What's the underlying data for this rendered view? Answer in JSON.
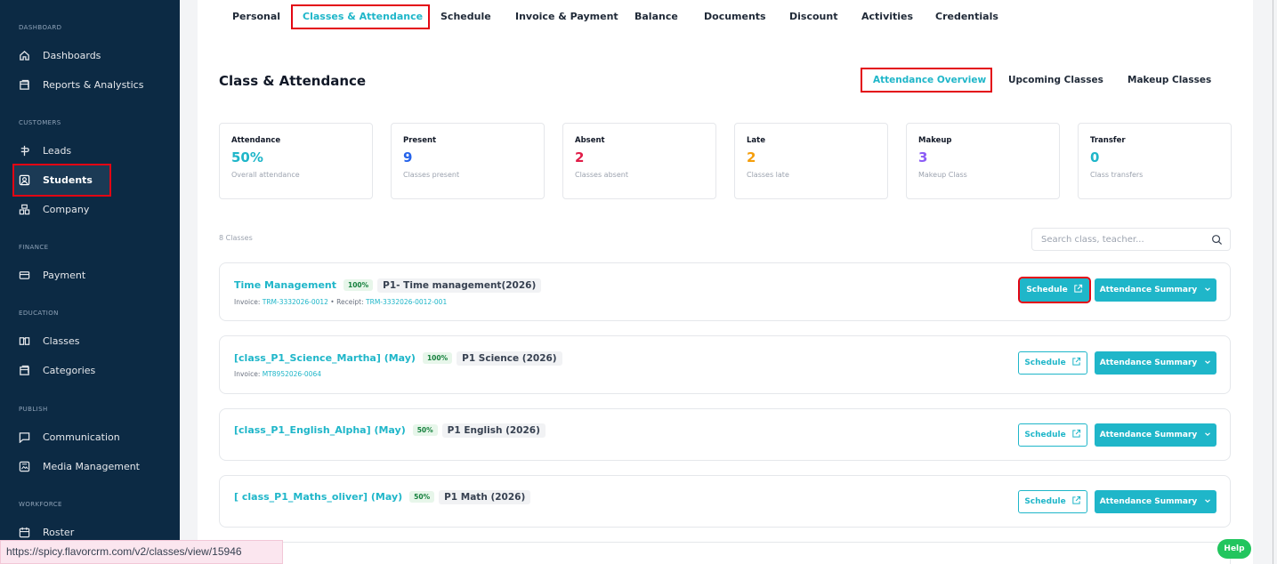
{
  "sidebar": {
    "sections": {
      "dashboard": "DASHBOARD",
      "customers": "CUSTOMERS",
      "finance": "FINANCE",
      "education": "EDUCATION",
      "publish": "PUBLISH",
      "workforce": "WORKFORCE"
    },
    "items": {
      "dashboards": "Dashboards",
      "reports": "Reports & Analystics",
      "leads": "Leads",
      "students": "Students",
      "company": "Company",
      "payment": "Payment",
      "classes": "Classes",
      "categories": "Categories",
      "communication": "Communication",
      "media": "Media Management",
      "roster": "Roster"
    }
  },
  "tabs": {
    "personal": "Personal",
    "classes_attendance": "Classes & Attendance",
    "schedule": "Schedule",
    "invoice_payment": "Invoice & Payment",
    "balance": "Balance",
    "documents": "Documents",
    "discount": "Discount",
    "activities": "Activities",
    "credentials": "Credentials"
  },
  "page_title": "Class & Attendance",
  "subtabs": {
    "overview": "Attendance Overview",
    "upcoming": "Upcoming Classes",
    "makeup": "Makeup Classes"
  },
  "stats": [
    {
      "label": "Attendance",
      "value": "50%",
      "sub": "Overall attendance",
      "color": "#1fb6c9"
    },
    {
      "label": "Present",
      "value": "9",
      "sub": "Classes present",
      "color": "#2563eb"
    },
    {
      "label": "Absent",
      "value": "2",
      "sub": "Classes absent",
      "color": "#e11d48"
    },
    {
      "label": "Late",
      "value": "2",
      "sub": "Classes late",
      "color": "#f59e0b"
    },
    {
      "label": "Makeup",
      "value": "3",
      "sub": "Makeup Class",
      "color": "#8b5cf6"
    },
    {
      "label": "Transfer",
      "value": "0",
      "sub": "Class transfers",
      "color": "#1fb6c9"
    }
  ],
  "class_count": "8 Classes",
  "search": {
    "placeholder": "Search class, teacher..."
  },
  "buttons": {
    "schedule": "Schedule",
    "attendance_summary": "Attendance Summary"
  },
  "cards": [
    {
      "name": "Time Management",
      "pct": "100%",
      "tag": "P1- Time management(2026)",
      "invoice_label": "Invoice: ",
      "invoice": "TRM-3332026-0012",
      "sep": " • Receipt: ",
      "receipt": "TRM-3332026-0012-001"
    },
    {
      "name": "[class_P1_Science_Martha] (May)",
      "pct": "100%",
      "tag": "P1 Science (2026)",
      "invoice_label": "Invoice: ",
      "invoice": "MT8952026-0064"
    },
    {
      "name": "[class_P1_English_Alpha] (May)",
      "pct": "50%",
      "tag": "P1 English (2026)"
    },
    {
      "name": "[ class_P1_Maths_oliver] (May)",
      "pct": "50%",
      "tag": "P1 Math (2026)"
    }
  ],
  "status_url": "https://spicy.flavorcrm.com/v2/classes/view/15946",
  "help": "Help"
}
